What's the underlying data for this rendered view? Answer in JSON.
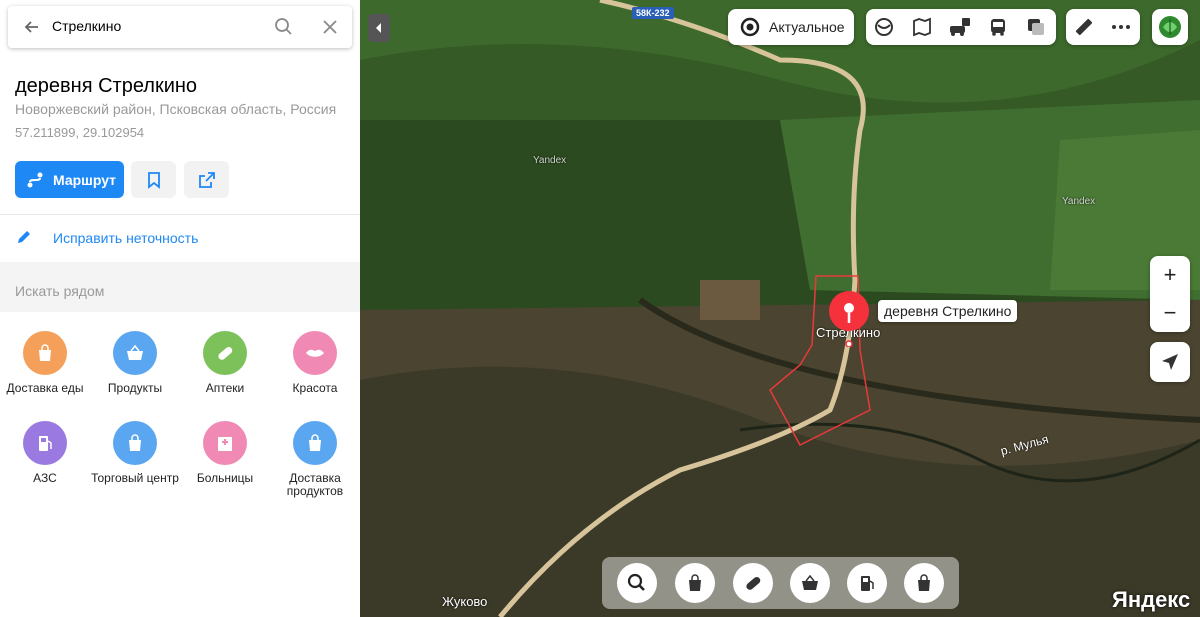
{
  "search": {
    "query": "Стрелкино"
  },
  "place": {
    "title": "деревня Стрелкино",
    "address": "Новоржевский район, Псковская область, Россия",
    "coordinates": "57.211899, 29.102954"
  },
  "actions": {
    "route_label": "Маршрут",
    "fix_label": "Исправить неточность"
  },
  "nearby": {
    "header": "Искать рядом",
    "categories": [
      {
        "label": "Доставка еды",
        "color": "#f5a05a",
        "icon": "bag-icon"
      },
      {
        "label": "Продукты",
        "color": "#5ba6f0",
        "icon": "basket-icon"
      },
      {
        "label": "Аптеки",
        "color": "#7dc15a",
        "icon": "pill-icon"
      },
      {
        "label": "Красота",
        "color": "#f08ab4",
        "icon": "lips-icon"
      },
      {
        "label": "АЗС",
        "color": "#9a7ae0",
        "icon": "fuel-icon"
      },
      {
        "label": "Торговый центр",
        "color": "#5ba6f0",
        "icon": "bag-icon"
      },
      {
        "label": "Больницы",
        "color": "#f08ab4",
        "icon": "hospital-icon"
      },
      {
        "label": "Доставка продуктов",
        "color": "#5ba6f0",
        "icon": "bag-icon"
      }
    ]
  },
  "map": {
    "layer_button": "Актуальное",
    "marker_label": "деревня Стрелкино",
    "village_label": "Стрелкино",
    "road_badge": "58К-232",
    "river_label": "р. Мулья",
    "village2": "Жуково",
    "watermark1": "Yandex",
    "watermark2": "Yandex",
    "brand": "Яндекс",
    "zoom_in": "+",
    "zoom_out": "−"
  }
}
